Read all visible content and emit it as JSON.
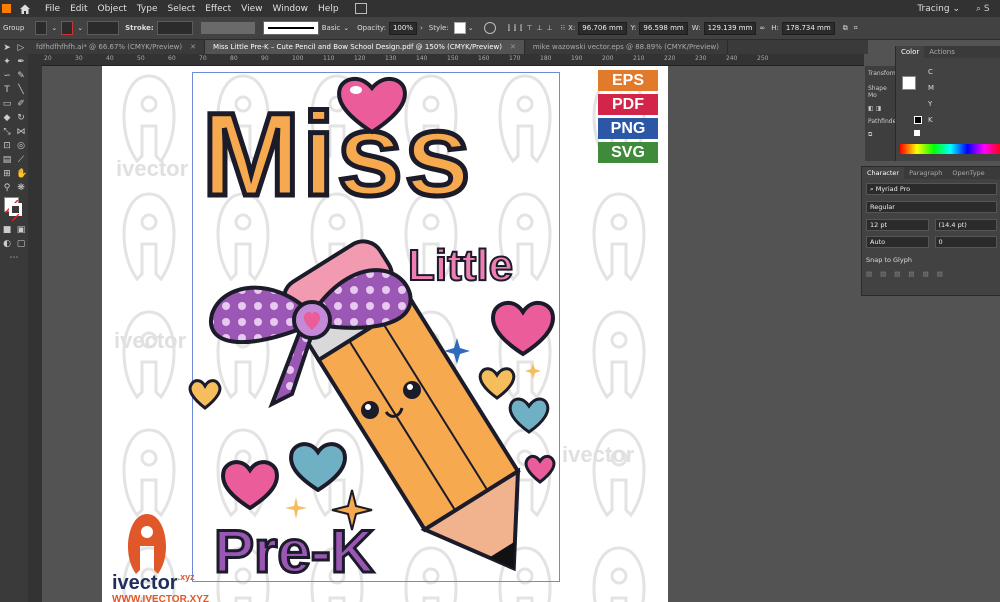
{
  "menu": {
    "items": [
      "File",
      "Edit",
      "Object",
      "Type",
      "Select",
      "Effect",
      "View",
      "Window",
      "Help"
    ],
    "workspace": "Tracing"
  },
  "control": {
    "selection": "Group",
    "stroke_label": "Stroke:",
    "brush": "Basic",
    "opacity_label": "Opacity:",
    "opacity_value": "100%",
    "style_label": "Style:",
    "x_label": "X:",
    "x_value": "96.706 mm",
    "y_label": "Y:",
    "y_value": "96.598 mm",
    "w_label": "W:",
    "w_value": "129.139 mm",
    "h_label": "H:",
    "h_value": "178.734 mm"
  },
  "tabs": [
    {
      "label": "fdfhdfhfhfh.ai* @ 66.67% (CMYK/Preview)",
      "active": false
    },
    {
      "label": "Miss Little Pre-K – Cute Pencil and Bow School Design.pdf @ 150% (CMYK/Preview)",
      "active": true
    },
    {
      "label": "mike wazowski vector.eps @ 88.89% (CMYK/Preview)",
      "active": false
    }
  ],
  "ruler": [
    "20",
    "30",
    "40",
    "50",
    "60",
    "70",
    "80",
    "90",
    "100",
    "110",
    "120",
    "130",
    "140",
    "150",
    "160",
    "170",
    "180",
    "190",
    "200",
    "210",
    "220",
    "230",
    "240",
    "250"
  ],
  "artwork": {
    "title_top": "Miss",
    "title_mid": "Little",
    "title_bottom": "Pre-K",
    "formats": [
      {
        "label": "EPS",
        "color": "#e27a2c"
      },
      {
        "label": "PDF",
        "color": "#d3244a"
      },
      {
        "label": "PNG",
        "color": "#2b57a6"
      },
      {
        "label": "SVG",
        "color": "#3f8a3b"
      }
    ],
    "watermark": "ivector",
    "logo_text": "ivector",
    "logo_suffix": ".xyz",
    "site_text": "WWW.IVECTOR.XYZ"
  },
  "color_panel": {
    "tabs": [
      "Color",
      "Actions"
    ],
    "channels": [
      "C",
      "M",
      "Y",
      "K"
    ]
  },
  "transform_panel": {
    "labels": [
      "Transform",
      "Shape Mo",
      "Pathfinder"
    ]
  },
  "character_panel": {
    "tabs": [
      "Character",
      "Paragraph",
      "OpenType"
    ],
    "font": "Myriad Pro",
    "style": "Regular",
    "size": "12 pt",
    "leading": "(14.4 pt)",
    "kerning": "Auto",
    "tracking": "0",
    "snap_label": "Snap to Glyph"
  },
  "colors": {
    "accent_orange": "#f6a94e",
    "accent_pink": "#ea5d9a",
    "accent_purple": "#9b57b4"
  }
}
